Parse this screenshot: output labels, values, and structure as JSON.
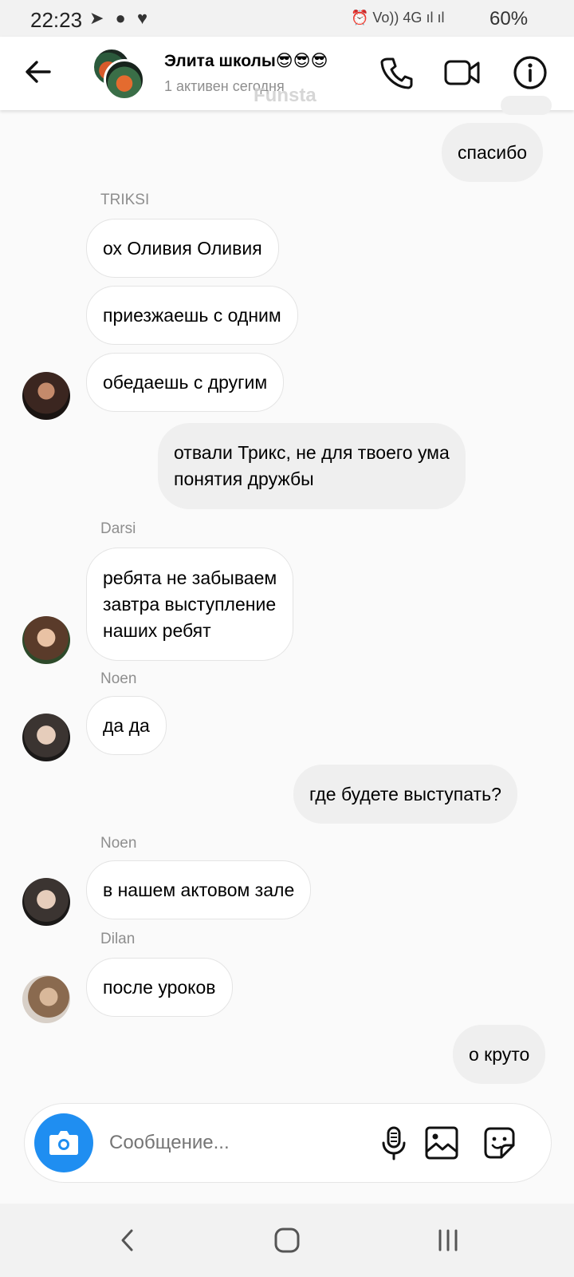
{
  "status_bar": {
    "time": "22:23",
    "left_icons": "➤ ● ♥",
    "right_icons": "⏰ Vo)) 4G ıl ıl",
    "battery": "60%"
  },
  "header": {
    "title": "Элита школы😎😎😎",
    "subtitle": "1 активен сегодня",
    "watermark": "Funsta"
  },
  "messages": [
    {
      "text": "спасибо"
    },
    {
      "sender": "TRIKSI"
    },
    {
      "text": "ох Оливия Оливия"
    },
    {
      "text": "приезжаешь с одним"
    },
    {
      "text": "обедаешь с другим"
    },
    {
      "text_line1": "отвали Трикс, не для твоего ума",
      "text_line2": "понятия дружбы"
    },
    {
      "sender": "Darsi"
    },
    {
      "text_line1": "ребята не забываем",
      "text_line2": "завтра выступление",
      "text_line3": "наших ребят"
    },
    {
      "sender": "Noen"
    },
    {
      "text": "да да"
    },
    {
      "text": "где будете выступать?"
    },
    {
      "sender": "Noen"
    },
    {
      "text": "в нашем актовом зале"
    },
    {
      "sender": "Dilan"
    },
    {
      "text": "после уроков"
    },
    {
      "text": "о круто"
    }
  ],
  "composer": {
    "placeholder": "Сообщение..."
  },
  "colors": {
    "accent": "#1f8ef1",
    "incoming_bubble": "#ffffff",
    "outgoing_bubble": "#efefef",
    "secondary_text": "#8e8e8e"
  },
  "icons": {
    "back": "arrow-left-icon",
    "call": "phone-icon",
    "video": "video-camera-icon",
    "info": "info-icon",
    "camera": "camera-icon",
    "mic": "microphone-icon",
    "gallery": "image-icon",
    "sticker": "sticker-icon"
  }
}
